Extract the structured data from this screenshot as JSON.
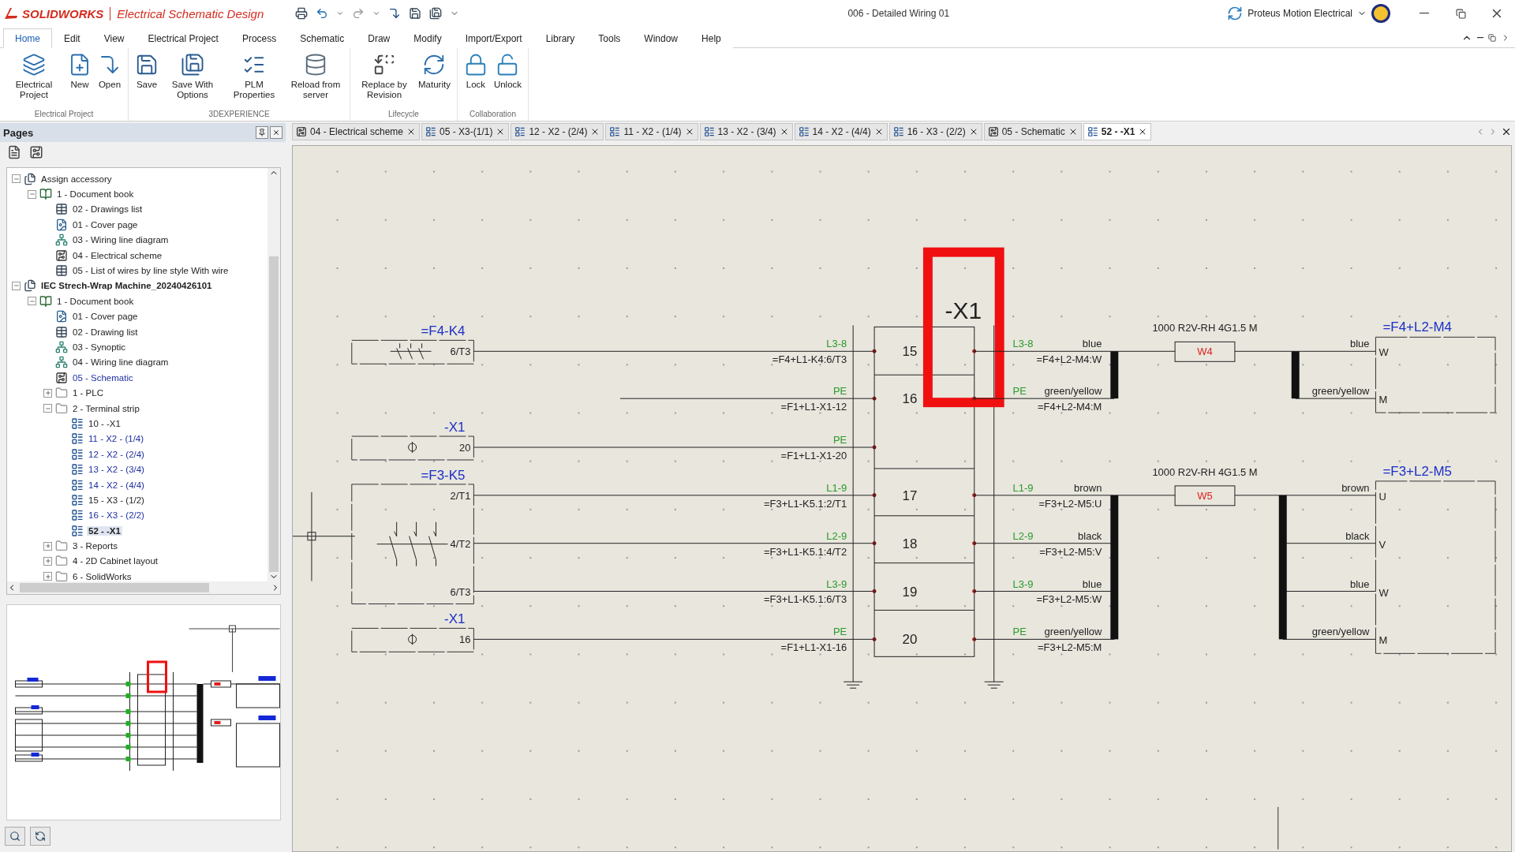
{
  "app": {
    "logo": "SOLIDWORKS",
    "product": "Electrical Schematic Design",
    "document": "006 - Detailed Wiring 01",
    "account": "Proteus Motion Electrical"
  },
  "menu": [
    {
      "label": "Home",
      "selected": true
    },
    {
      "label": "Edit",
      "selected": false
    },
    {
      "label": "View",
      "selected": false
    },
    {
      "label": "Electrical Project",
      "selected": false
    },
    {
      "label": "Process",
      "selected": false
    },
    {
      "label": "Schematic",
      "selected": false
    },
    {
      "label": "Draw",
      "selected": false
    },
    {
      "label": "Modify",
      "selected": false
    },
    {
      "label": "Import/Export",
      "selected": false
    },
    {
      "label": "Library",
      "selected": false
    },
    {
      "label": "Tools",
      "selected": false
    },
    {
      "label": "Window",
      "selected": false
    },
    {
      "label": "Help",
      "selected": false
    }
  ],
  "ribbon": [
    {
      "label": "Electrical Project",
      "buttons": [
        "Electrical Project",
        "New",
        "Open"
      ]
    },
    {
      "label": "3DEXPERIENCE",
      "buttons": [
        "Save",
        "Save With Options",
        "PLM Properties",
        "Reload from server"
      ]
    },
    {
      "label": "Lifecycle",
      "buttons": [
        "Replace by Revision",
        "Maturity"
      ]
    },
    {
      "label": "Collaboration",
      "buttons": [
        "Lock",
        "Unlock"
      ]
    }
  ],
  "pages_panel": {
    "title": "Pages",
    "tree": [
      {
        "label": "Assign accessory",
        "kind": "project",
        "expanded": true,
        "active": false,
        "children": [
          {
            "label": "1 - Document book",
            "kind": "book",
            "expanded": true,
            "children": [
              {
                "label": "02 - Drawings list",
                "kind": "list",
                "open": false,
                "selected": false
              },
              {
                "label": "01 - Cover page",
                "kind": "cover",
                "open": false,
                "selected": false
              },
              {
                "label": "03 - Wiring line diagram",
                "kind": "diagram",
                "open": false,
                "selected": false
              },
              {
                "label": "04 - Electrical scheme",
                "kind": "scheme",
                "open": false,
                "selected": false
              },
              {
                "label": "05 - List of wires by line style With wire",
                "kind": "list",
                "open": false,
                "selected": false
              }
            ]
          }
        ]
      },
      {
        "label": "IEC Strech-Wrap Machine_20240426101",
        "kind": "project",
        "expanded": true,
        "active": true,
        "children": [
          {
            "label": "1 - Document book",
            "kind": "book",
            "expanded": true,
            "children": [
              {
                "label": "01 - Cover page",
                "kind": "cover",
                "open": false,
                "selected": false
              },
              {
                "label": "02 - Drawing list",
                "kind": "list",
                "open": false,
                "selected": false
              },
              {
                "label": "03 - Synoptic",
                "kind": "diagram",
                "open": false,
                "selected": false
              },
              {
                "label": "04 - Wiring line diagram",
                "kind": "diagram",
                "open": false,
                "selected": false
              },
              {
                "label": "05 - Schematic",
                "kind": "scheme",
                "open": true,
                "selected": false
              },
              {
                "label": "1 - PLC",
                "kind": "folder",
                "expanded": false
              },
              {
                "label": "2 - Terminal strip",
                "kind": "folder",
                "expanded": true,
                "children": [
                  {
                    "label": "10 - -X1",
                    "kind": "terminal",
                    "open": false,
                    "selected": false
                  },
                  {
                    "label": "11 - X2 - (1/4)",
                    "kind": "terminal",
                    "open": true,
                    "selected": false
                  },
                  {
                    "label": "12 - X2 - (2/4)",
                    "kind": "terminal",
                    "open": true,
                    "selected": false
                  },
                  {
                    "label": "13 - X2 - (3/4)",
                    "kind": "terminal",
                    "open": true,
                    "selected": false
                  },
                  {
                    "label": "14 - X2 - (4/4)",
                    "kind": "terminal",
                    "open": true,
                    "selected": false
                  },
                  {
                    "label": "15 - X3 - (1/2)",
                    "kind": "terminal",
                    "open": false,
                    "selected": false
                  },
                  {
                    "label": "16 - X3 - (2/2)",
                    "kind": "terminal",
                    "open": true,
                    "selected": false
                  },
                  {
                    "label": "52 - -X1",
                    "kind": "terminal",
                    "open": false,
                    "selected": true
                  }
                ]
              },
              {
                "label": "3 - Reports",
                "kind": "folder",
                "expanded": false
              },
              {
                "label": "4 - 2D Cabinet layout",
                "kind": "folder",
                "expanded": false
              },
              {
                "label": "6 - SolidWorks",
                "kind": "folder",
                "expanded": false
              }
            ]
          }
        ]
      }
    ]
  },
  "doc_tabs": [
    {
      "label": "04 - Electrical scheme",
      "kind": "scheme",
      "selected": false
    },
    {
      "label": "05 - X3-(1/1)",
      "kind": "page",
      "selected": false
    },
    {
      "label": "12 - X2 - (2/4)",
      "kind": "page",
      "selected": false
    },
    {
      "label": "11 - X2 - (1/4)",
      "kind": "page",
      "selected": false
    },
    {
      "label": "13 - X2 - (3/4)",
      "kind": "page",
      "selected": false
    },
    {
      "label": "14 - X2 - (4/4)",
      "kind": "page",
      "selected": false
    },
    {
      "label": "16 - X3 - (2/2)",
      "kind": "page",
      "selected": false
    },
    {
      "label": "05 - Schematic",
      "kind": "scheme",
      "selected": false
    },
    {
      "label": "52 - -X1",
      "kind": "page",
      "selected": true
    }
  ],
  "schematic": {
    "strip": {
      "label": "-X1",
      "terminals": [
        "15",
        "16",
        "17",
        "18",
        "19",
        "20"
      ]
    },
    "devices": [
      {
        "tag": "=F4-K4",
        "kind": "contactor",
        "pins": [
          "6/T3"
        ]
      },
      {
        "tag": "-X1",
        "kind": "terminal",
        "pins": [
          "20"
        ]
      },
      {
        "tag": "=F3-K5",
        "kind": "contactor",
        "pins": [
          "2/T1",
          "4/T2",
          "6/T3"
        ]
      },
      {
        "tag": "-X1",
        "kind": "terminal",
        "pins": [
          "16"
        ]
      }
    ],
    "incoming": [
      {
        "wire": "L3-8",
        "reference": "=F4+L1-K4:6/T3"
      },
      {
        "wire": "PE",
        "reference": "=F1+L1-X1-12"
      },
      {
        "wire": "PE",
        "reference": "=F1+L1-X1-20"
      },
      {
        "wire": "L1-9",
        "reference": "=F3+L1-K5.1:2/T1"
      },
      {
        "wire": "L2-9",
        "reference": "=F3+L1-K5.1:4/T2"
      },
      {
        "wire": "L3-9",
        "reference": "=F3+L1-K5.1:6/T3"
      },
      {
        "wire": "PE",
        "reference": "=F1+L1-X1-16"
      }
    ],
    "cables": [
      {
        "spec": "1000 R2V-RH 4G1.5 M",
        "name": "W4",
        "motor": "=F4+L2-M4",
        "cores": [
          {
            "wire": "L3-8",
            "strip_end": "blue",
            "reference": "=F4+L2-M4:W",
            "motor_end": "blue",
            "pin": "W"
          },
          {
            "wire": "PE",
            "strip_end": "green/yellow",
            "reference": "=F4+L2-M4:M",
            "motor_end": "green/yellow",
            "pin": "M"
          }
        ]
      },
      {
        "spec": "1000 R2V-RH 4G1.5 M",
        "name": "W5",
        "motor": "=F3+L2-M5",
        "cores": [
          {
            "wire": "L1-9",
            "strip_end": "brown",
            "reference": "=F3+L2-M5:U",
            "motor_end": "brown",
            "pin": "U"
          },
          {
            "wire": "L2-9",
            "strip_end": "black",
            "reference": "=F3+L2-M5:V",
            "motor_end": "black",
            "pin": "V"
          },
          {
            "wire": "L3-9",
            "strip_end": "blue",
            "reference": "=F3+L2-M5:W",
            "motor_end": "blue",
            "pin": "W"
          },
          {
            "wire": "PE",
            "strip_end": "green/yellow",
            "reference": "=F3+L2-M5:M",
            "motor_end": "green/yellow",
            "pin": "M"
          }
        ]
      }
    ]
  }
}
